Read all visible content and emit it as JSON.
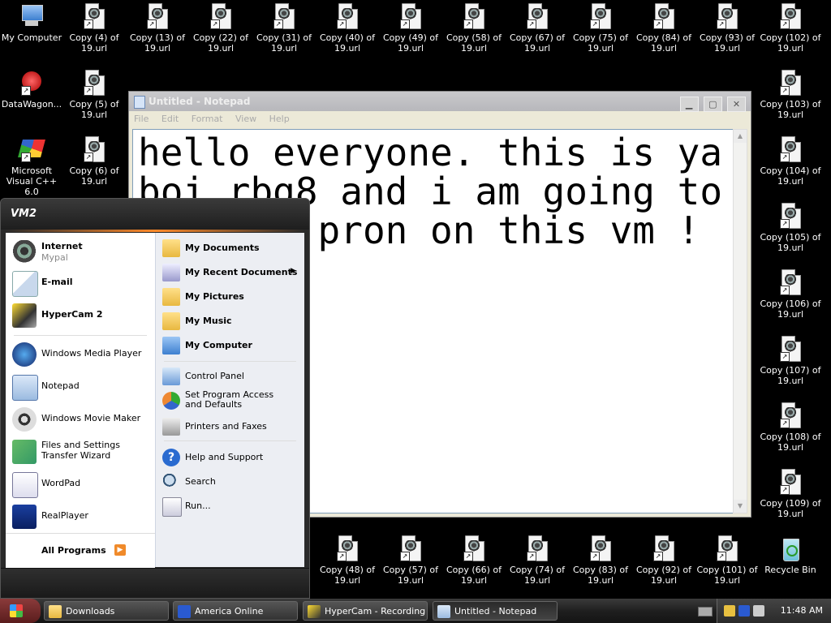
{
  "desktop": {
    "top_row": [
      {
        "label": "My Computer",
        "icon": "my-computer-icon"
      },
      {
        "label": "Copy (4) of 19.url",
        "icon": "url-shortcut-icon"
      },
      {
        "label": "Copy (13) of 19.url",
        "icon": "url-shortcut-icon"
      },
      {
        "label": "Copy (22) of 19.url",
        "icon": "url-shortcut-icon"
      },
      {
        "label": "Copy (31) of 19.url",
        "icon": "url-shortcut-icon"
      },
      {
        "label": "Copy (40) of 19.url",
        "icon": "url-shortcut-icon"
      },
      {
        "label": "Copy (49) of 19.url",
        "icon": "url-shortcut-icon"
      },
      {
        "label": "Copy (58) of 19.url",
        "icon": "url-shortcut-icon"
      },
      {
        "label": "Copy (67) of 19.url",
        "icon": "url-shortcut-icon"
      },
      {
        "label": "Copy (75) of 19.url",
        "icon": "url-shortcut-icon"
      },
      {
        "label": "Copy (84) of 19.url",
        "icon": "url-shortcut-icon"
      },
      {
        "label": "Copy (93) of 19.url",
        "icon": "url-shortcut-icon"
      },
      {
        "label": "Copy (102) of 19.url",
        "icon": "url-shortcut-icon"
      }
    ],
    "left_column": [
      {
        "label": "DataWagon...",
        "icon": "datawagon-icon"
      },
      {
        "label": "Microsoft Visual C++ 6.0",
        "icon": "visual-cpp-icon"
      }
    ],
    "second_column": [
      {
        "label": "Copy (5) of 19.url"
      },
      {
        "label": "Copy (6) of 19.url"
      }
    ],
    "right_column": [
      {
        "label": "Copy (103) of 19.url"
      },
      {
        "label": "Copy (104) of 19.url"
      },
      {
        "label": "Copy (105) of 19.url"
      },
      {
        "label": "Copy (106) of 19.url"
      },
      {
        "label": "Copy (107) of 19.url"
      },
      {
        "label": "Copy (108) of 19.url"
      },
      {
        "label": "Copy (109) of 19.url"
      }
    ],
    "bottom_row": [
      {
        "label": "Copy (48) of 19.url"
      },
      {
        "label": "Copy (57) of 19.url"
      },
      {
        "label": "Copy (66) of 19.url"
      },
      {
        "label": "Copy (74) of 19.url"
      },
      {
        "label": "Copy (83) of 19.url"
      },
      {
        "label": "Copy (92) of 19.url"
      },
      {
        "label": "Copy (101) of 19.url"
      },
      {
        "label": "Recycle Bin"
      }
    ]
  },
  "notepad": {
    "title": "Untitled - Notepad",
    "menu": [
      "File",
      "Edit",
      "Format",
      "View",
      "Help"
    ],
    "content": "hello everyone. this is ya boi rbg8 and i am going to look up pron on this vm ! :)))",
    "buttons": {
      "minimize": "▁",
      "maximize": "▢",
      "close": "✕"
    }
  },
  "start_menu": {
    "user": "VM2",
    "pinned": [
      {
        "name": "Internet",
        "sub": "Mypal"
      },
      {
        "name": "E-mail"
      }
    ],
    "recent": [
      {
        "name": "HyperCam 2"
      },
      {
        "name": "Windows Media Player"
      },
      {
        "name": "Notepad"
      },
      {
        "name": "Windows Movie Maker"
      },
      {
        "name": "Files and Settings Transfer Wizard"
      },
      {
        "name": "WordPad"
      },
      {
        "name": "RealPlayer"
      }
    ],
    "all_programs": "All Programs",
    "right": [
      {
        "name": "My Documents"
      },
      {
        "name": "My Recent Documents"
      },
      {
        "name": "My Pictures"
      },
      {
        "name": "My Music"
      },
      {
        "name": "My Computer"
      },
      {
        "name": "Control Panel"
      },
      {
        "name": "Set Program Access and Defaults"
      },
      {
        "name": "Printers and Faxes"
      },
      {
        "name": "Help and Support"
      },
      {
        "name": "Search"
      },
      {
        "name": "Run..."
      }
    ]
  },
  "taskbar": {
    "tasks": [
      "Downloads",
      "America  Online",
      "HyperCam - Recording",
      "Untitled - Notepad"
    ],
    "clock": "11:48 AM"
  },
  "colors": {
    "desktop_bg": "#000000",
    "start_menu_accent": "#ff8a2a",
    "start_button": "#6b2424",
    "taskbar": "#1f1f1f"
  }
}
